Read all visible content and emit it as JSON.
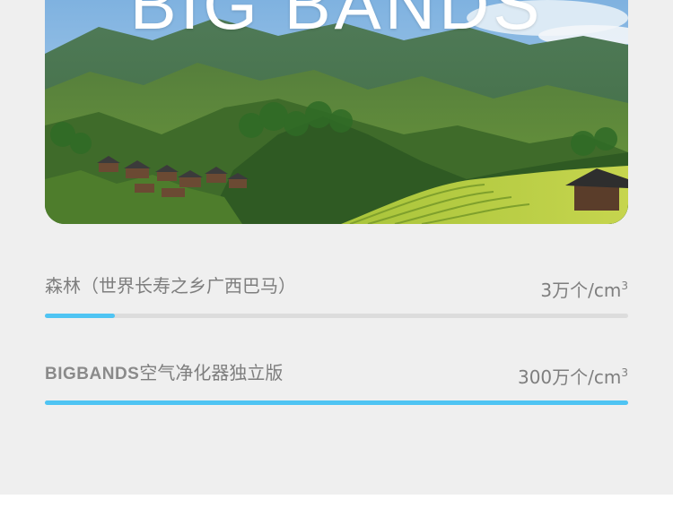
{
  "hero": {
    "title": "BIG BANDS",
    "image": "mountain-terraced-village-landscape"
  },
  "comparison": {
    "accent_color": "#4fc4f3",
    "track_color": "#dcdcdc",
    "rows": [
      {
        "label": "森林（世界长寿之乡广西巴马）",
        "value": "3万个/cm",
        "unit_superscript": "3",
        "progress": 0.12
      },
      {
        "brand": "BIGBANDS",
        "label": "空气净化器独立版",
        "value": "300万个/cm",
        "unit_superscript": "3",
        "progress": 1.0
      }
    ]
  }
}
